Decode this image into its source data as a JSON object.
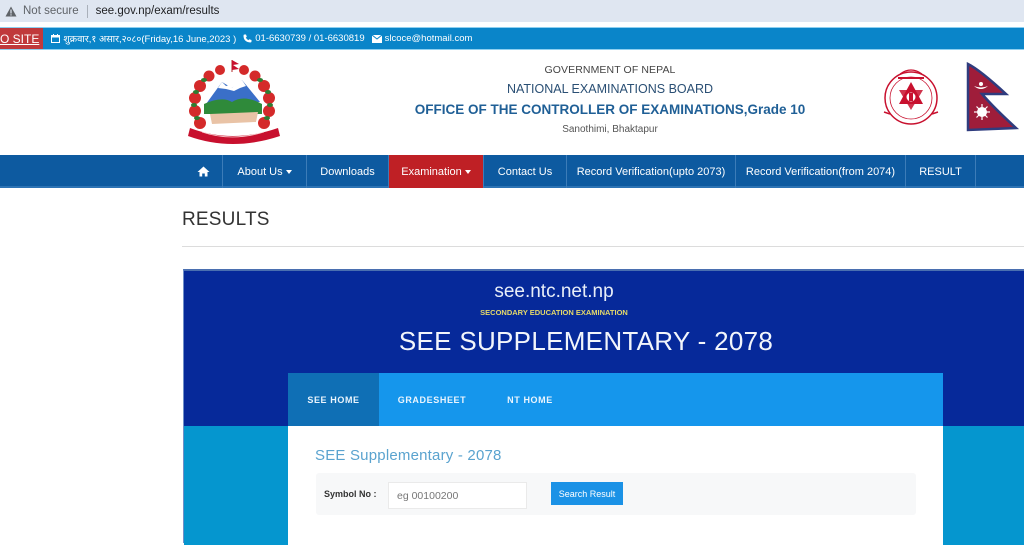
{
  "browser": {
    "security_label": "Not secure",
    "url": "see.gov.np/exam/results"
  },
  "info_strip": {
    "old_site_label": "O SITE",
    "date": "शुक्रवार,१ असार,२०८०(Friday,16 June,2023 )",
    "phone": "01-6630739 / 01-6630819",
    "email": "slcoce@hotmail.com"
  },
  "header": {
    "line1": "GOVERNMENT OF NEPAL",
    "line2": "NATIONAL EXAMINATIONS BOARD",
    "line3": "OFFICE OF THE CONTROLLER OF EXAMINATIONS,Grade 10",
    "line4": "Sanothimi, Bhaktapur"
  },
  "nav": {
    "items": [
      {
        "label": "About Us",
        "dropdown": true
      },
      {
        "label": "Downloads",
        "dropdown": false
      },
      {
        "label": "Examination",
        "dropdown": true,
        "active": true
      },
      {
        "label": "Contact Us",
        "dropdown": false
      },
      {
        "label": "Record Verification(upto 2073)",
        "dropdown": false
      },
      {
        "label": "Record Verification(from 2074)",
        "dropdown": false
      },
      {
        "label": "RESULT",
        "dropdown": false
      }
    ]
  },
  "page": {
    "title": "RESULTS"
  },
  "panel": {
    "domain": "see.ntc.net.np",
    "subtitle": "SECONDARY EDUCATION EXAMINATION",
    "title": "SEE SUPPLEMENTARY - 2078",
    "tabs": [
      {
        "label": "SEE HOME",
        "active": true
      },
      {
        "label": "GRADESHEET",
        "active": false
      },
      {
        "label": "NT HOME",
        "active": false
      }
    ],
    "card_title": "SEE Supplementary - 2078",
    "form": {
      "symbol_label": "Symbol No :",
      "symbol_value": "",
      "symbol_placeholder": "eg 00100200",
      "search_button": "Search Result"
    }
  },
  "colors": {
    "info_strip": "#0a85c9",
    "nav": "#0d5aa0",
    "nav_active": "#bf2025",
    "panel_dark": "#06299a",
    "panel_light": "#0596cf",
    "tab_bar": "#1596ec",
    "tab_active": "#0f6fb5",
    "button": "#1b92e6"
  }
}
